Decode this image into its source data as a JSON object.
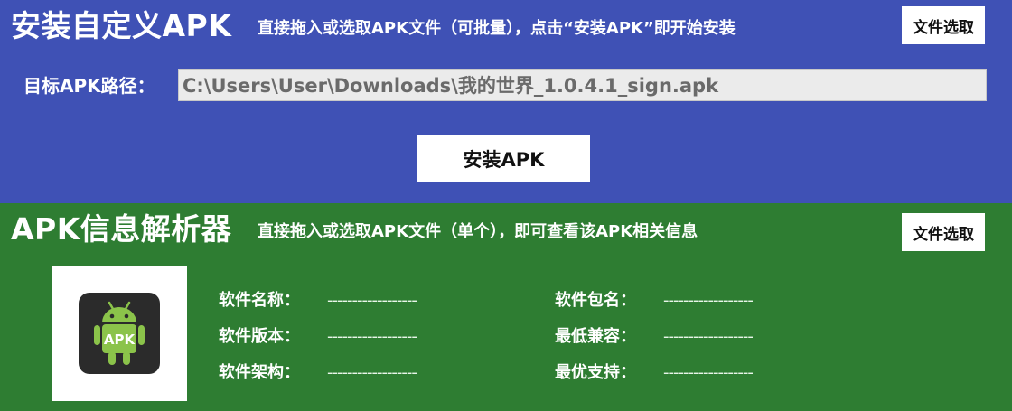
{
  "install": {
    "title": "安装自定义APK",
    "subtitle": "直接拖入或选取APK文件（可批量），点击“安装APK”即开始安装",
    "file_button": "文件选取",
    "path_label": "目标APK路径：",
    "path_value": "C:\\Users\\User\\Downloads\\我的世界_1.0.4.1_sign.apk",
    "install_button": "安装APK"
  },
  "parser": {
    "title": "APK信息解析器",
    "subtitle": "直接拖入或选取APK文件（单个），即可查看该APK相关信息",
    "file_button": "文件选取",
    "icon_text": "APK",
    "fields": [
      {
        "label": "软件名称：",
        "value": "------------------"
      },
      {
        "label": "软件包名：",
        "value": "------------------"
      },
      {
        "label": "软件版本：",
        "value": "------------------"
      },
      {
        "label": "最低兼容：",
        "value": "------------------"
      },
      {
        "label": "软件架构：",
        "value": "------------------"
      },
      {
        "label": "最优支持：",
        "value": "------------------"
      }
    ]
  },
  "colors": {
    "install_bg": "#3f51b5",
    "parser_bg": "#2e7d32",
    "android_green": "#8bc34a"
  },
  "icons": [
    "android-apk-icon"
  ]
}
